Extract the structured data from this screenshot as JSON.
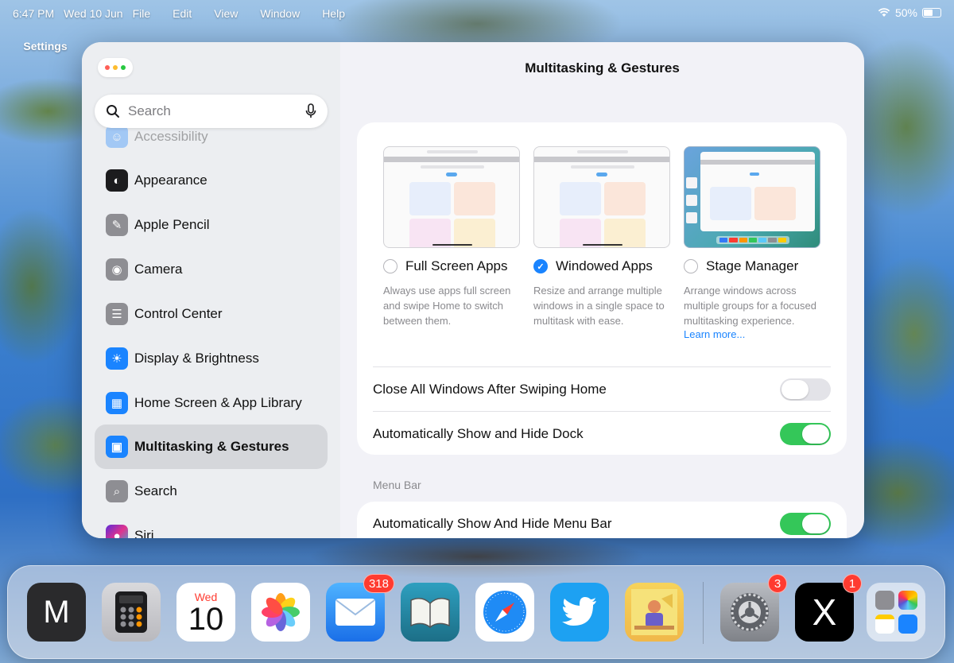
{
  "menubar": {
    "time": "6:47 PM",
    "date": "Wed 10 Jun",
    "app_name": "Settings",
    "menus": [
      "File",
      "Edit",
      "View",
      "Window",
      "Help"
    ],
    "battery": "50%"
  },
  "sidebar": {
    "search_placeholder": "Search",
    "partial_top_label": "Accessibility",
    "items": [
      {
        "label": "Appearance",
        "icon": "appearance-icon",
        "color": "#1c1c1e"
      },
      {
        "label": "Apple Pencil",
        "icon": "pencil-icon",
        "color": "#8e8e93"
      },
      {
        "label": "Camera",
        "icon": "camera-icon",
        "color": "#8e8e93"
      },
      {
        "label": "Control Center",
        "icon": "toggles-icon",
        "color": "#8e8e93"
      },
      {
        "label": "Display & Brightness",
        "icon": "sun-icon",
        "color": "#1a84ff"
      },
      {
        "label": "Home Screen & App Library",
        "icon": "home-grid-icon",
        "color": "#1a84ff"
      },
      {
        "label": "Multitasking & Gestures",
        "icon": "multitasking-icon",
        "color": "#1a84ff",
        "selected": true
      },
      {
        "label": "Search",
        "icon": "search-icon",
        "color": "#8e8e93"
      },
      {
        "label": "Siri",
        "icon": "siri-icon",
        "color": "#5b2bd9"
      }
    ]
  },
  "content": {
    "title": "Multitasking & Gestures",
    "options": [
      {
        "label": "Full Screen Apps",
        "description": "Always use apps full screen and swipe Home to switch between them.",
        "selected": false
      },
      {
        "label": "Windowed Apps",
        "description": "Resize and arrange multiple windows in a single space to multitask with ease.",
        "selected": true
      },
      {
        "label": "Stage Manager",
        "description": "Arrange windows across multiple groups for a focused multitasking experience.",
        "link": "Learn more...",
        "selected": false
      }
    ],
    "toggles": [
      {
        "label": "Close All Windows After Swiping Home",
        "on": false
      },
      {
        "label": "Automatically Show and Hide Dock",
        "on": true
      }
    ],
    "section_header": "Menu Bar",
    "menubar_toggle": {
      "label": "Automatically Show And Hide Menu Bar",
      "on": true
    }
  },
  "dock": {
    "apps": [
      {
        "name": "Mastodon-M",
        "glyph": "M"
      },
      {
        "name": "Calculator"
      },
      {
        "name": "Calendar",
        "day": "Wed",
        "date": "10"
      },
      {
        "name": "Photos"
      },
      {
        "name": "Mail",
        "badge": "318"
      },
      {
        "name": "Books"
      },
      {
        "name": "Safari"
      },
      {
        "name": "Twitter"
      },
      {
        "name": "Illustration"
      },
      {
        "name": "Settings",
        "badge": "3"
      },
      {
        "name": "X",
        "glyph": "X",
        "badge": "1"
      },
      {
        "name": "App Library"
      }
    ]
  }
}
